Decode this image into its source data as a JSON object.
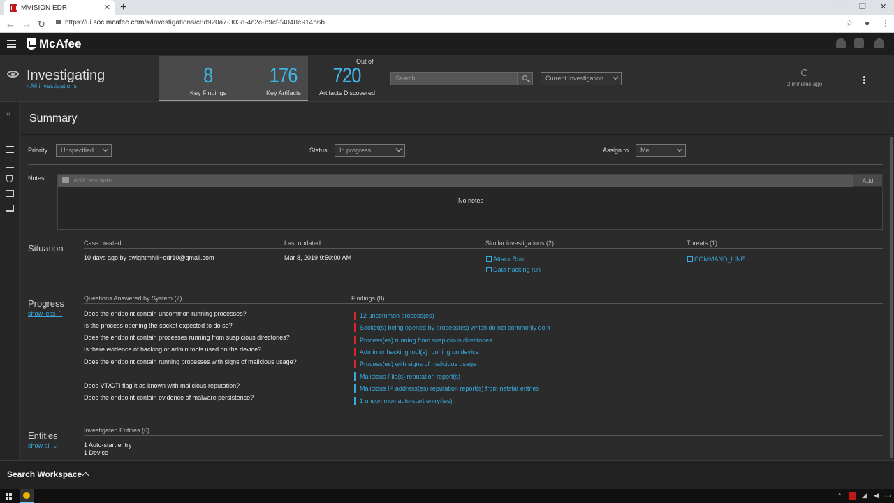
{
  "browser": {
    "tab_title": "MVISION EDR",
    "url_prefix": "https://",
    "url_host": "ui.soc.mcafee.com",
    "url_path": "/#/investigations/c8d920a7-303d-4c2e-b9cf-f4048e914b6b"
  },
  "app": {
    "brand": "McAfee"
  },
  "header": {
    "title": "Investigating",
    "back_link": "All investigations",
    "key_findings_count": "8",
    "key_findings_label": "Key Findings",
    "key_artifacts_count": "176",
    "key_artifacts_label": "Key Artifacts",
    "out_of_label": "Out of",
    "artifacts_discovered_count": "720",
    "artifacts_discovered_label": "Artifacts Discovered",
    "search_placeholder": "Search",
    "scope_select": "Current Investigation",
    "refresh_time": "2 minutes ago"
  },
  "summary": {
    "title": "Summary",
    "priority_label": "Priority",
    "priority_value": "Unspecified",
    "status_label": "Status",
    "status_value": "In progress",
    "assign_label": "Assign to",
    "assign_value": "Me",
    "notes_label": "Notes",
    "notes_placeholder": "Add new note",
    "notes_add": "Add",
    "no_notes": "No notes"
  },
  "situation": {
    "title": "Situation",
    "case_created_label": "Case created",
    "case_created_value": "10 days ago by dwightmhill+edr10@gmail.com",
    "last_updated_label": "Last updated",
    "last_updated_value": "Mar 8, 2019 9:50:00 AM",
    "similar_label": "Similar investigations (2)",
    "similar": [
      "Attack Run",
      "Data hacking run"
    ],
    "threats_label": "Threats (1)",
    "threats": [
      "COMMAND_LINE"
    ]
  },
  "progress": {
    "title": "Progress",
    "toggle": "show less",
    "questions_label": "Questions Answered by System (7)",
    "questions": [
      "Does the endpoint contain uncommon running processes?",
      "Is the process opening the socket expected to do so?",
      "Does the endpoint contain processes running from suspicious directories?",
      "Is there evidence of hacking or admin tools used on the device?",
      "Does the endpoint contain running processes with signs of malicious usage?",
      "Does VT/GTI flag it as known with malicious reputation?",
      "Does the endpoint contain evidence of malware persistence?"
    ],
    "findings_label": "Findings (8)",
    "findings": [
      {
        "text": "12 uncommon process(es)",
        "severity": "high"
      },
      {
        "text": "Socket(s) being opened by process(es) which do not commonly do it",
        "severity": "high"
      },
      {
        "text": "Process(es) running from suspicious directories",
        "severity": "high"
      },
      {
        "text": "Admin or hacking tool(s) running on device",
        "severity": "high"
      },
      {
        "text": "Process(es) with signs of malicious usage",
        "severity": "high"
      },
      {
        "text": "Malicious File(s) reputation report(s)",
        "severity": "info"
      },
      {
        "text": "Malicious IP address(es) reputation report(s) from netstat entries",
        "severity": "info"
      },
      {
        "text": "1 uncommon auto-start entry(ies)",
        "severity": "info"
      }
    ]
  },
  "entities": {
    "title": "Entities",
    "toggle": "show all",
    "investigated_label": "Investigated Entities (6)",
    "items": [
      "1 Auto-start entry",
      "1 Device"
    ]
  },
  "workspace": {
    "label": "Search Workspace"
  },
  "colors": {
    "accent": "#3fb4e8",
    "link": "#39a9dc",
    "high": "#d9262c",
    "info": "#39a9dc"
  }
}
